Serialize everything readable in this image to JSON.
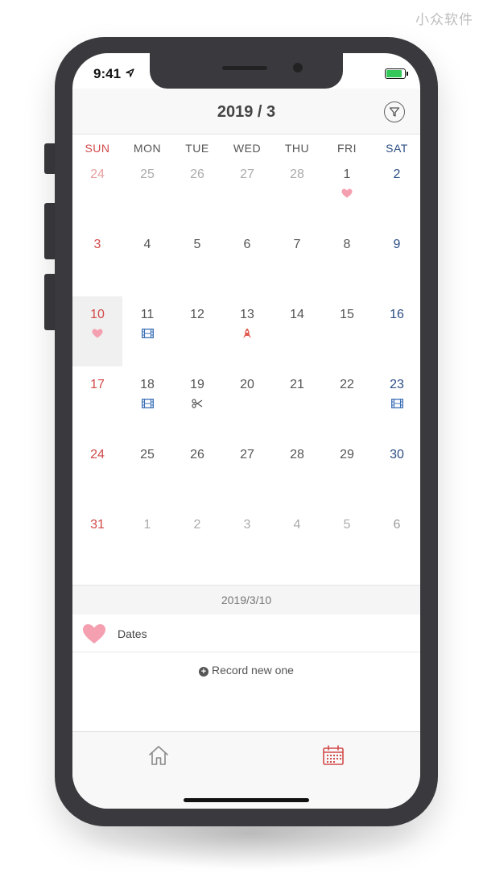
{
  "watermark": "小众软件",
  "status": {
    "time": "9:41"
  },
  "header": {
    "title": "2019 / 3"
  },
  "weekdays": [
    "SUN",
    "MON",
    "TUE",
    "WED",
    "THU",
    "FRI",
    "SAT"
  ],
  "calendar": {
    "weeks": [
      [
        {
          "day": "24",
          "other": true
        },
        {
          "day": "25",
          "other": true
        },
        {
          "day": "26",
          "other": true
        },
        {
          "day": "27",
          "other": true
        },
        {
          "day": "28",
          "other": true
        },
        {
          "day": "1",
          "icon": "heart-icon"
        },
        {
          "day": "2"
        }
      ],
      [
        {
          "day": "3"
        },
        {
          "day": "4"
        },
        {
          "day": "5"
        },
        {
          "day": "6"
        },
        {
          "day": "7"
        },
        {
          "day": "8"
        },
        {
          "day": "9"
        }
      ],
      [
        {
          "day": "10",
          "icon": "heart-icon",
          "selected": true
        },
        {
          "day": "11",
          "icon": "film-icon"
        },
        {
          "day": "12"
        },
        {
          "day": "13",
          "icon": "rocket-icon"
        },
        {
          "day": "14"
        },
        {
          "day": "15"
        },
        {
          "day": "16"
        }
      ],
      [
        {
          "day": "17"
        },
        {
          "day": "18",
          "icon": "film-icon"
        },
        {
          "day": "19",
          "icon": "scissors-icon"
        },
        {
          "day": "20"
        },
        {
          "day": "21"
        },
        {
          "day": "22"
        },
        {
          "day": "23",
          "icon": "film-icon"
        }
      ],
      [
        {
          "day": "24"
        },
        {
          "day": "25"
        },
        {
          "day": "26"
        },
        {
          "day": "27"
        },
        {
          "day": "28"
        },
        {
          "day": "29"
        },
        {
          "day": "30"
        }
      ],
      [
        {
          "day": "31"
        },
        {
          "day": "1",
          "other": true
        },
        {
          "day": "2",
          "other": true
        },
        {
          "day": "3",
          "other": true
        },
        {
          "day": "4",
          "other": true
        },
        {
          "day": "5",
          "other": true
        },
        {
          "day": "6",
          "other": true
        }
      ]
    ]
  },
  "selected_date": "2019/3/10",
  "records": [
    {
      "icon": "heart-icon",
      "label": "Dates"
    }
  ],
  "new_record_label": "Record new one",
  "tabbar": {
    "items": [
      {
        "icon": "home-icon",
        "active": false
      },
      {
        "icon": "calendar-icon",
        "active": true
      }
    ]
  },
  "colors": {
    "sunday": "#d24a4a",
    "saturday": "#2c4d84",
    "heart": "#f4a0b0",
    "film": "#3b6fb5",
    "rocket": "#e05a4e",
    "tab_active": "#d24a4a",
    "battery": "#34c759"
  }
}
